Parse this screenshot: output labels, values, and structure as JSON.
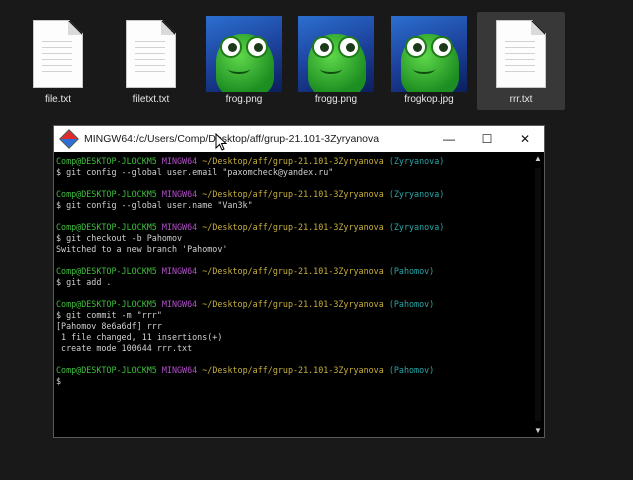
{
  "files": [
    {
      "name": "file.txt",
      "kind": "text",
      "selected": false
    },
    {
      "name": "filetxt.txt",
      "kind": "text",
      "selected": false
    },
    {
      "name": "frog.png",
      "kind": "image",
      "selected": false
    },
    {
      "name": "frogg.png",
      "kind": "image",
      "selected": false
    },
    {
      "name": "frogkop.jpg",
      "kind": "image",
      "selected": false
    },
    {
      "name": "rrr.txt",
      "kind": "text",
      "selected": true
    }
  ],
  "terminal": {
    "title": "MINGW64:/c/Users/Comp/Desktop/aff/grup-21.101-3Zyryanova",
    "controls": {
      "minimize": "—",
      "maximize": "☐",
      "close": "✕"
    },
    "prompt": {
      "user_host": "Comp@DESKTOP-JLOCKM5",
      "system": "MINGW64",
      "path": "~/Desktop/aff/grup-21.101-3Zyryanova"
    },
    "blocks": [
      {
        "branch": "(Zyryanova)",
        "command": "$ git config --global user.email \"paxomcheck@yandex.ru\"",
        "output": []
      },
      {
        "branch": "(Zyryanova)",
        "command": "$ git config --global user.name \"Van3k\"",
        "output": []
      },
      {
        "branch": "(Zyryanova)",
        "command": "$ git checkout -b Pahomov",
        "output": [
          "Switched to a new branch 'Pahomov'"
        ]
      },
      {
        "branch": "(Pahomov)",
        "command": "$ git add .",
        "output": []
      },
      {
        "branch": "(Pahomov)",
        "command": "$ git commit -m \"rrr\"",
        "output": [
          "[Pahomov 8e6a6df] rrr",
          " 1 file changed, 11 insertions(+)",
          " create mode 100644 rrr.txt"
        ]
      },
      {
        "branch": "(Pahomov)",
        "command": "$ ",
        "output": []
      }
    ]
  },
  "colors": {
    "background": "#191919",
    "prompt_user": "#3fbf3f",
    "prompt_system": "#b250c9",
    "prompt_path": "#c8b03a",
    "prompt_branch": "#2aa6a6",
    "terminal_text": "#d0d0d0"
  }
}
